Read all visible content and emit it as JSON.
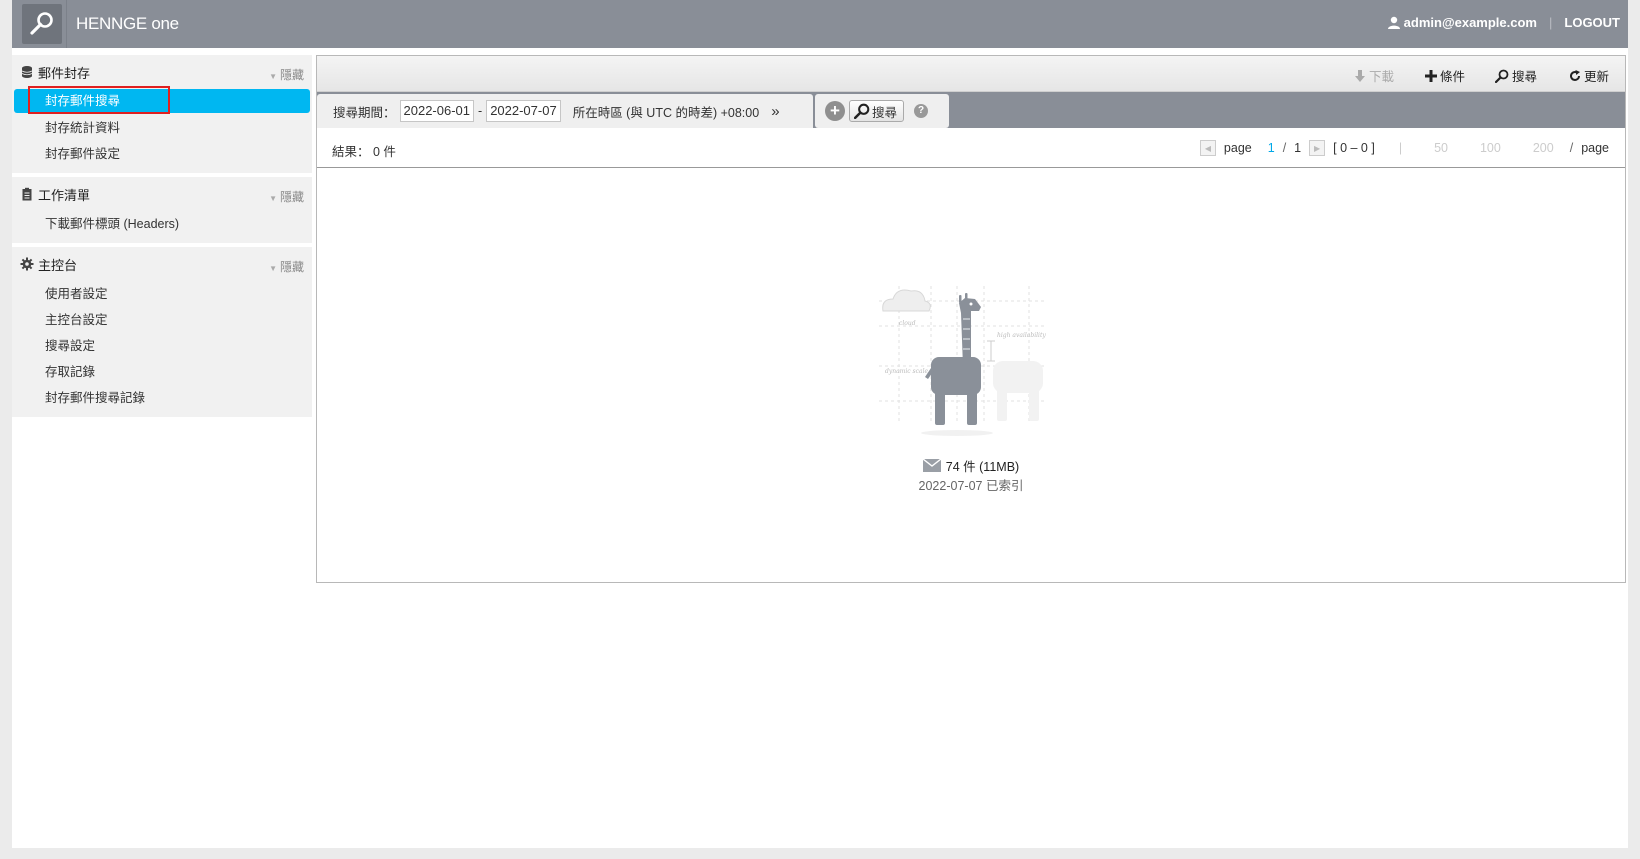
{
  "header": {
    "brand": "HENNGE one",
    "user": "admin@example.com",
    "logout": "LOGOUT"
  },
  "sidebar": {
    "hide_label": "隱藏",
    "sections": [
      {
        "title": "郵件封存",
        "items": [
          "封存郵件搜尋",
          "封存統計資料",
          "封存郵件設定"
        ]
      },
      {
        "title": "工作清單",
        "items": [
          "下載郵件標頭 (Headers)"
        ]
      },
      {
        "title": "主控台",
        "items": [
          "使用者設定",
          "主控台設定",
          "搜尋設定",
          "存取記錄",
          "封存郵件搜尋記錄"
        ]
      }
    ]
  },
  "toolbar": {
    "download": "下載",
    "conditions": "條件",
    "search": "搜尋",
    "refresh": "更新"
  },
  "search": {
    "period_label": "搜尋期間：",
    "date_from": "2022-06-01",
    "date_sep": "-",
    "date_to": "2022-07-07",
    "timezone": "所在時區 (與 UTC 的時差) +08:00",
    "expand": "»",
    "search_button": "搜尋",
    "help": "?"
  },
  "results": {
    "label": "結果：",
    "count": "0 件",
    "page_label": "page",
    "current_page": "1",
    "slash": "/",
    "total_pages": "1",
    "range": "[ 0 – 0 ]",
    "divider": "|",
    "sizes": [
      "50",
      "100",
      "200"
    ],
    "per_page": "page"
  },
  "empty_state": {
    "count": "74 件 (11MB)",
    "indexed": "2022-07-07 已索引"
  },
  "colors": {
    "header_bg": "#898e97",
    "active_item": "#00b7f1",
    "highlight_border": "#e02020",
    "page_link": "#00a8e8"
  }
}
